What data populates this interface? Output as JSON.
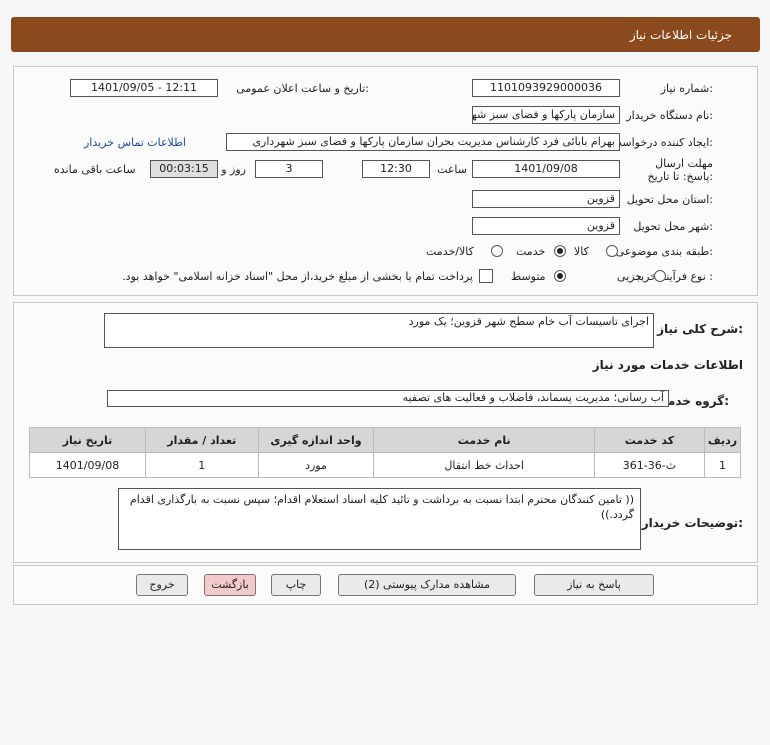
{
  "header": {
    "title": "جزئیات اطلاعات نیاز"
  },
  "form": {
    "need_number_label": "شماره نیاز:",
    "need_number": "1101093929000036",
    "announce_label": "تاریخ و ساعت اعلان عمومی:",
    "announce_value": "1401/09/05 - 12:11",
    "buyer_org_label": "نام دستگاه خریدار:",
    "buyer_org": "سازمان پارکها و فضای سبز شهرداری قزوین",
    "requester_label": "ایجاد کننده درخواست:",
    "requester": "بهرام بابائی فرد کارشناس مدیریت بحران سازمان پارکها و فضای سبز شهرداری",
    "contact_link": "اطلاعات تماس خریدار",
    "deadline_label": "مهلت ارسال پاسخ: تا تاریخ:",
    "deadline_date": "1401/09/08",
    "time_label": "ساعت",
    "deadline_time": "12:30",
    "days_value": "3",
    "days_label": "روز و",
    "remaining_value": "00:03:15",
    "remaining_label": "ساعت باقی مانده",
    "province_label": "استان محل تحویل:",
    "province": "قزوین",
    "city_label": "شهر محل تحویل:",
    "city": "قزوین",
    "category_label": "طبقه بندی موضوعی:",
    "category_options": [
      "کالا",
      "خدمت",
      "کالا/خدمت"
    ],
    "category_selected": "خدمت",
    "process_label": "نوع فرآیند خرید :",
    "process_options": [
      "جزیی",
      "متوسط"
    ],
    "process_selected": "متوسط",
    "treasury_note": "پرداخت تمام یا بخشی از مبلغ خرید،از محل \"اسناد خزانه اسلامی\" خواهد بود."
  },
  "details": {
    "summary_label": "شرح کلی نیاز:",
    "summary": "اجرای تاسیسات  آب خام سطح شهر قزوین؛ یک مورد",
    "services_title": "اطلاعات خدمات مورد نیاز",
    "service_group_label": "گروه خدمت:",
    "service_group": "آب رسانی؛ مدیریت پسماند، فاضلاب و فعالیت های تصفیه",
    "table_headers": [
      "ردیف",
      "کد خدمت",
      "نام خدمت",
      "واحد اندازه گیری",
      "تعداد / مقدار",
      "تاریخ نیاز"
    ],
    "rows": [
      [
        "1",
        "ث-36-361",
        "احداث خط انتقال",
        "مورد",
        "1",
        "1401/09/08"
      ]
    ],
    "buyer_notes_label": "توضیحات خریدار:",
    "buyer_notes": "(( تامین کنندگان محترم ابتدا نسبت به برداشت و تائید کلیه اسناد استعلام اقدام؛ سپس نسبت به بارگذاری اقدام گردد.))"
  },
  "actions": {
    "reply": "پاسخ به نیاز",
    "attachments": "مشاهده مدارک پیوستی (2)",
    "print": "چاپ",
    "back": "بازگشت",
    "exit": "خروج"
  }
}
